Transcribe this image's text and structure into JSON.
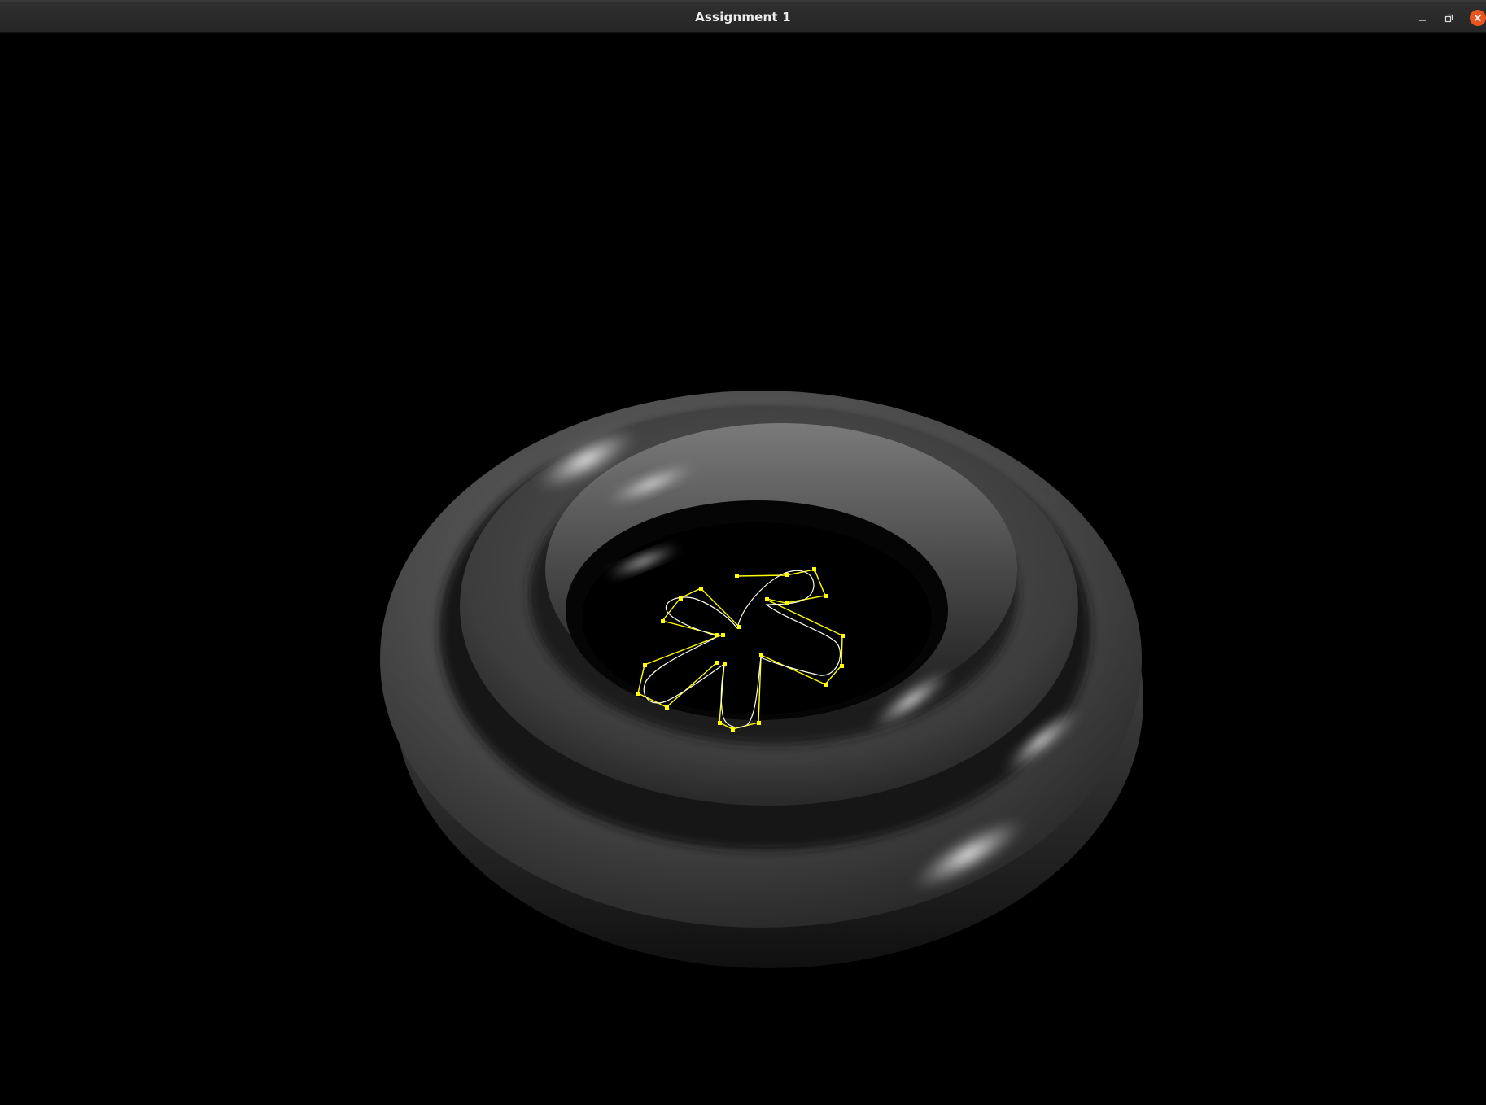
{
  "window": {
    "title": "Assignment 1",
    "controls": {
      "minimize": "minimize-icon",
      "maximize": "restore-icon",
      "close": "close-icon"
    },
    "close_color": "#e9541f"
  },
  "scene": {
    "background": "#000000",
    "mesh_color": "#8a8a8a",
    "curve_color": "#ffff00",
    "control_point_color": "#ffff00"
  }
}
